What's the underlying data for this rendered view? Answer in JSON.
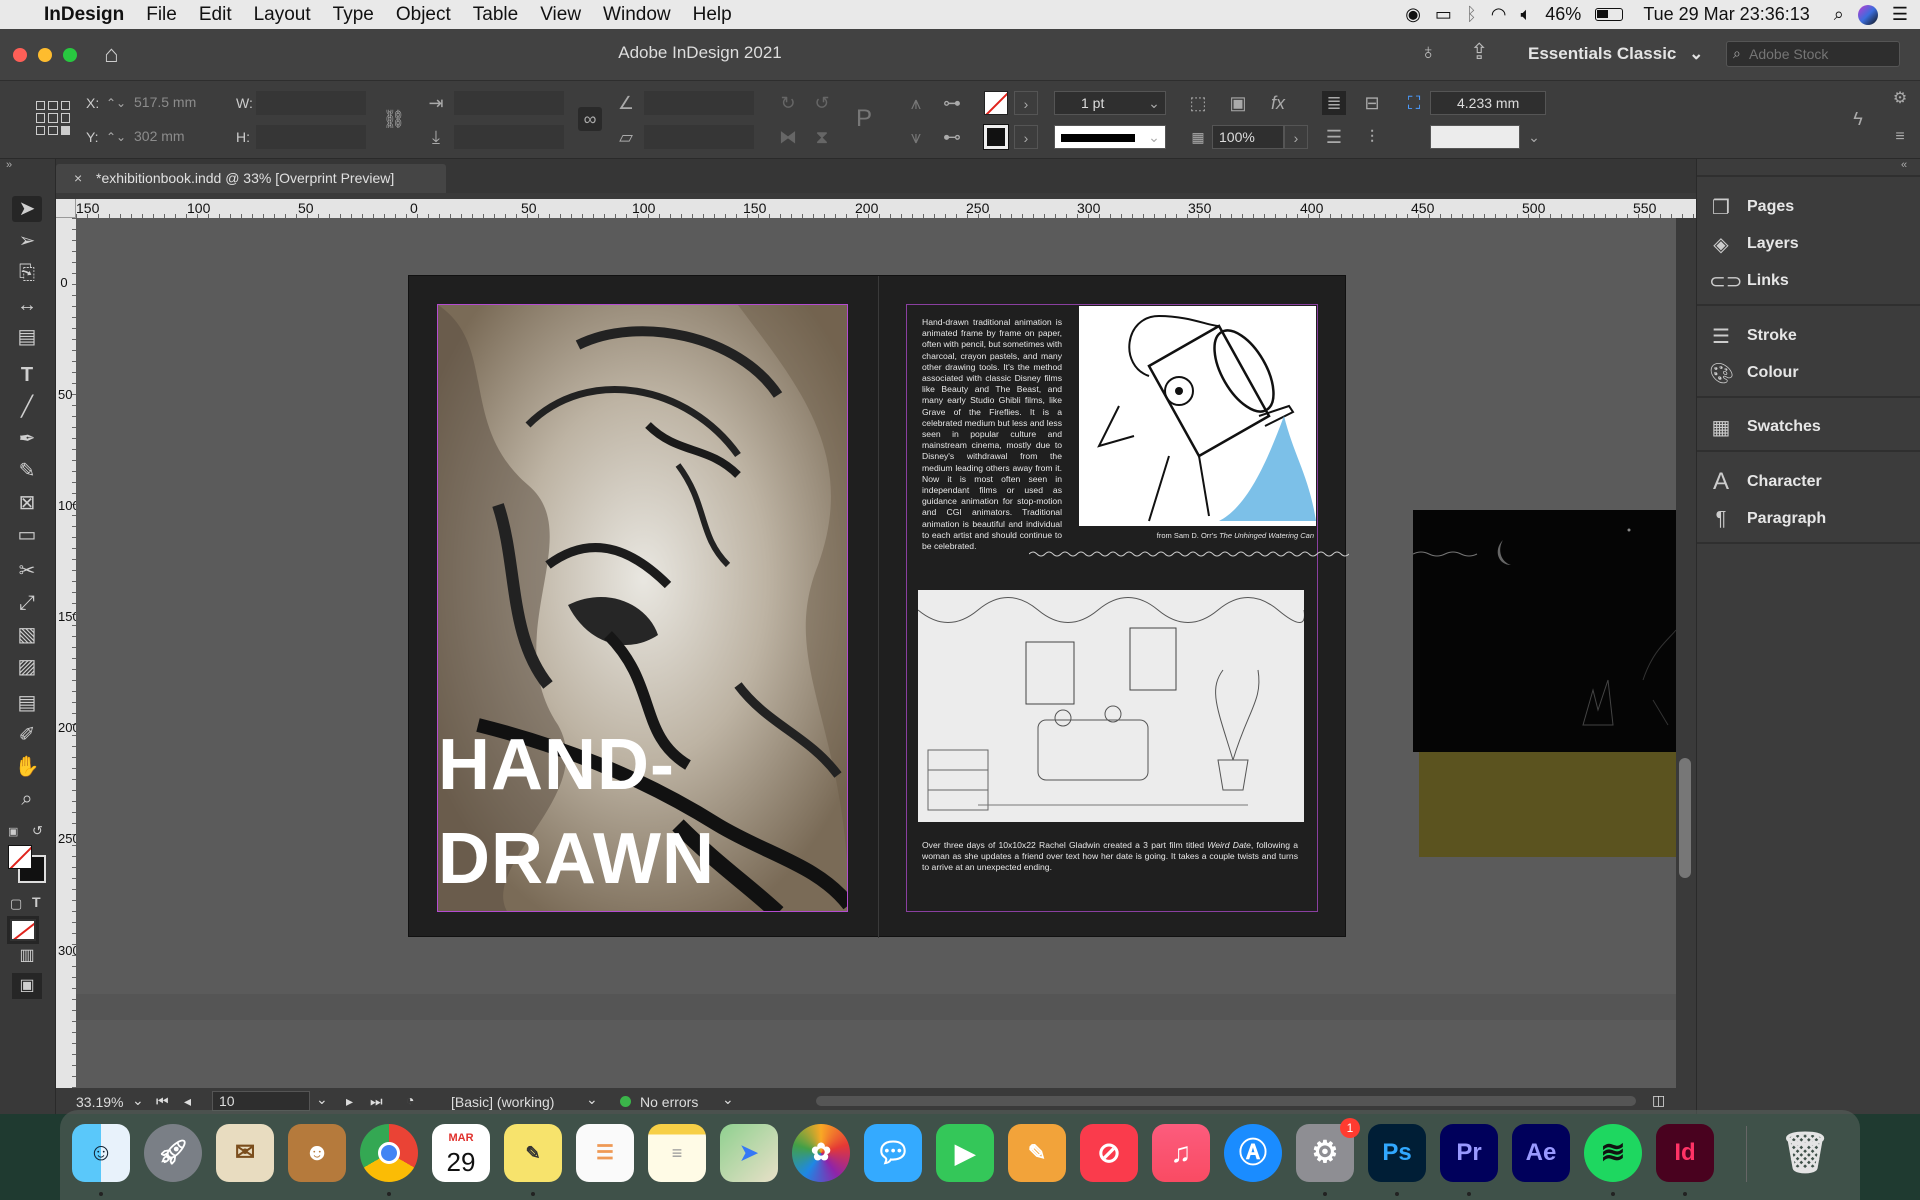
{
  "menubar": {
    "app_name": "InDesign",
    "items": [
      "File",
      "Edit",
      "Layout",
      "Type",
      "Object",
      "Table",
      "View",
      "Window",
      "Help"
    ],
    "battery": "46%",
    "datetime": "Tue 29 Mar  23:36:13"
  },
  "titlebar": {
    "window_title": "Adobe InDesign 2021",
    "workspace": "Essentials Classic",
    "stock_search_placeholder": "Adobe Stock"
  },
  "control": {
    "x_label": "X:",
    "x_value": "517.5 mm",
    "y_label": "Y:",
    "y_value": "302 mm",
    "w_label": "W:",
    "h_label": "H:",
    "stroke_weight": "1 pt",
    "opacity": "100%",
    "offset": "4.233 mm"
  },
  "document_tab": "*exhibitionbook.indd @ 33% [Overprint Preview]",
  "ruler": {
    "h_ticks": [
      "150",
      "100",
      "50",
      "0",
      "50",
      "100",
      "150",
      "200",
      "250",
      "300",
      "350",
      "400",
      "450",
      "500",
      "550"
    ],
    "v_ticks": [
      "0",
      "50",
      "100",
      "150",
      "200",
      "250",
      "300"
    ]
  },
  "spread": {
    "headline_1": "HAND-",
    "headline_2": "DRAWN",
    "body_1": "Hand-drawn traditional animation is animated frame by frame on paper, often with pencil, but sometimes with charcoal, crayon pastels, and many other drawing tools. It's the method associated with classic Disney films like Beauty and The Beast, and many early Studio Ghibli films, like Grave of the Fireflies. It is a celebrated medium but less and less seen in popular culture and mainstream cinema, mostly due to Disney's withdrawal from the medium leading others away from it. Now it is most often seen in independant films or used as guidance animation for stop-motion and CGI animators. Traditional animation is beautiful and individual to each artist and should continue to be celebrated.",
    "caption_prefix": "from Sam D. Orr's ",
    "caption_title": "The Unhinged Watering Can",
    "body_2_a": "Over three days of 10x10x22 Rachel Gladwin created a 3 part film titled ",
    "body_2_title": "Weird Date",
    "body_2_b": ", following a woman as she updates a friend over text how her date is going. It takes a couple twists and turns to arrive at an unexpected ending."
  },
  "status": {
    "zoom": "33.19%",
    "page": "10",
    "style": "[Basic] (working)",
    "preflight": "No errors"
  },
  "panels": [
    {
      "label": "Pages",
      "icon": "pages-icon"
    },
    {
      "label": "Layers",
      "icon": "layers-icon"
    },
    {
      "label": "Links",
      "icon": "links-icon"
    },
    {
      "label": "Stroke",
      "icon": "stroke-icon"
    },
    {
      "label": "Colour",
      "icon": "colour-icon"
    },
    {
      "label": "Swatches",
      "icon": "swatches-icon"
    },
    {
      "label": "Character",
      "icon": "character-icon"
    },
    {
      "label": "Paragraph",
      "icon": "paragraph-icon"
    }
  ],
  "dock": {
    "calendar_month": "MAR",
    "calendar_day": "29",
    "settings_badge": "1",
    "apps": [
      "Finder",
      "Launchpad",
      "Mail",
      "Contacts",
      "Chrome",
      "Calendar",
      "Stickies",
      "Reminders",
      "Notes",
      "Maps",
      "Photos",
      "Messages",
      "FaceTime",
      "Pages",
      "News",
      "Music",
      "App Store",
      "System Preferences",
      "Photoshop",
      "Premiere Pro",
      "After Effects",
      "Spotify",
      "InDesign",
      "Trash"
    ],
    "ps_label": "Ps",
    "pr_label": "Pr",
    "ae_label": "Ae",
    "id_label": "Id"
  },
  "colors": {
    "accent_indesign": "#49021f",
    "frame_magenta": "#b44bd1"
  }
}
